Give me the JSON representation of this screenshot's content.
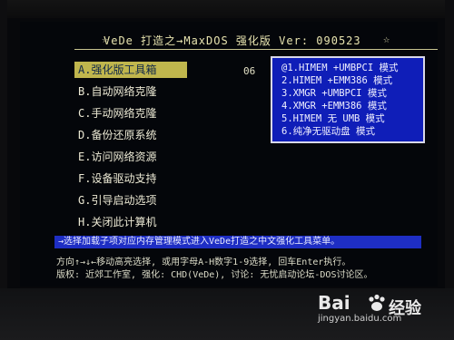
{
  "title": "VeDe 打造之→MaxDOS 强化版  Ver: 090523",
  "countdown": "06",
  "menu": [
    "A.强化版工具箱",
    "B.自动网络克隆",
    "C.手动网络克隆",
    "D.备份还原系统",
    "E.访问网络资源",
    "F.设备驱动支持",
    "G.引导启动选项",
    "H.关闭此计算机"
  ],
  "modes": [
    "@1.HIMEM +UMBPCI 模式",
    "2.HIMEM +EMM386 模式",
    "3.XMGR +UMBPCI 模式",
    "4.XMGR +EMM386 模式",
    "5.HIMEM 无 UMB 模式",
    "6.纯净无驱动盘 模式"
  ],
  "hint": "→选择加载子项对应内存管理模式进入VeDe打造之中文强化工具菜单。",
  "status": {
    "line1": "方向↑→↓←移动高亮选择, 或用字母A-H数字1-9选择, 回车Enter执行。",
    "line2": "版权: 近郊工作室, 强化: CHD(VeDe), 讨论: 无忧启动论坛-DOS讨论区。"
  },
  "watermark": {
    "brand": "Bai",
    "cn": "经验",
    "url": "jingyan.baidu.com"
  },
  "colors": {
    "selected_bg": "#c0b64d",
    "box_bg": "#0f1eb8",
    "hint_bg": "#1e2ec4"
  }
}
